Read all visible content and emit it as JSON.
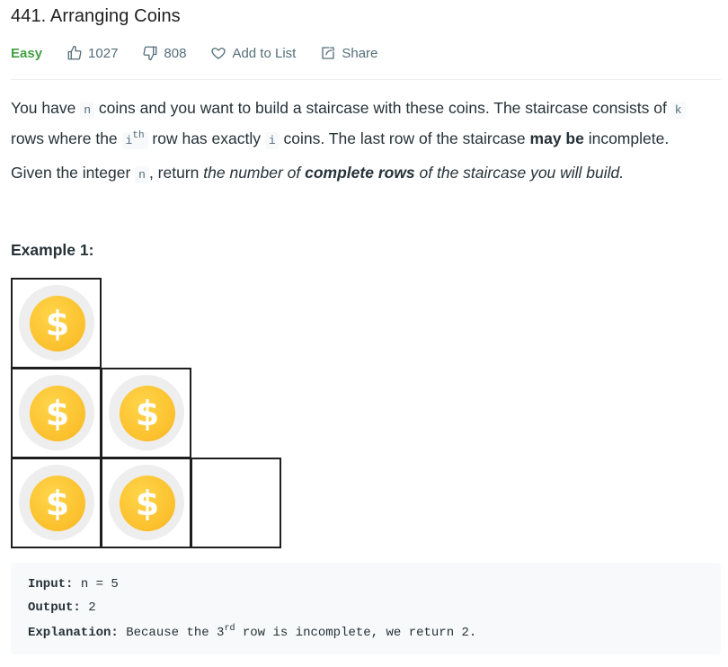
{
  "problem": {
    "title": "441. Arranging Coins",
    "difficulty": "Easy",
    "likes": "1027",
    "dislikes": "808",
    "add_to_list": "Add to List",
    "share": "Share"
  },
  "colors": {
    "easy": "#43a047",
    "coin": "#fbc02d",
    "code_bg": "#f7f9fa"
  },
  "icons": {
    "like": "thumbs-up-icon",
    "dislike": "thumbs-down-icon",
    "add": "heart-icon",
    "share": "share-icon",
    "coin": "dollar-coin-icon"
  },
  "description": {
    "p1": {
      "t1": "You have ",
      "c1": "n",
      "t2": " coins and you want to build a staircase with these coins. The staircase consists of ",
      "c2": "k",
      "t3": " rows where the ",
      "c3": "i",
      "sup": "th",
      "t4": " row has exactly ",
      "c4": "i",
      "t5": " coins. The last row of the staircase ",
      "bold": "may be",
      "t6": " incomplete."
    },
    "p2": {
      "t1": "Given the integer ",
      "c1": "n",
      "t2": ", return ",
      "em1": "the number of ",
      "strong": "complete rows",
      "em2": " of the staircase you will build."
    }
  },
  "example": {
    "title": "Example 1:",
    "coin_symbol": "$",
    "rows": [
      1,
      2,
      2
    ],
    "input_label": "Input:",
    "input_value": " n = 5",
    "output_label": "Output:",
    "output_value": " 2",
    "explanation_label": "Explanation:",
    "explanation_a": " Because the 3",
    "explanation_sup": "rd",
    "explanation_b": " row is incomplete, we return 2."
  }
}
